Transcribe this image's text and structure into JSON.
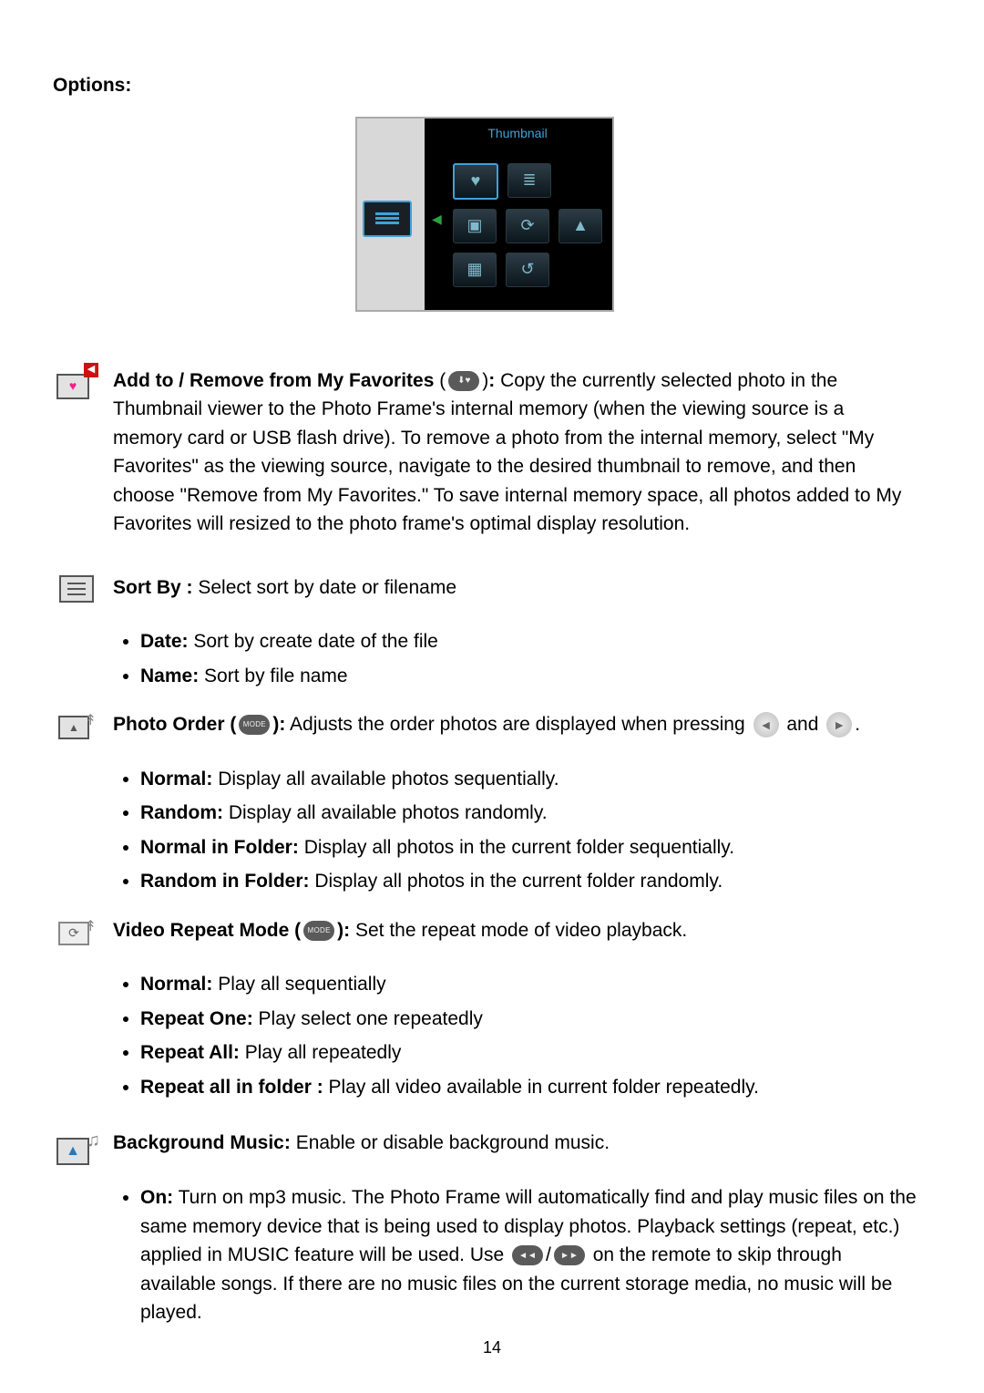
{
  "title": "Options:",
  "thumbnail_label": "Thumbnail",
  "favorites": {
    "heading": "Add to / Remove from My Favorites",
    "body": " Copy the currently selected photo in the Thumbnail viewer to the Photo Frame's internal memory (when the viewing source is a memory card or USB flash drive). To remove a photo from the internal memory, select \"My Favorites\" as the viewing source, navigate to the desired thumbnail to remove, and then choose \"Remove from My Favorites.\" To save internal memory space, all photos added to My Favorites will resized to the photo frame's optimal display resolution."
  },
  "sortby": {
    "heading": "Sort By :",
    "body": " Select sort by date or filename",
    "items": [
      {
        "label": "Date:",
        "text": " Sort by create date of the file"
      },
      {
        "label": "Name:",
        "text": " Sort by file name"
      }
    ]
  },
  "photoOrder": {
    "heading": "Photo Order (",
    "heading2": "):",
    "body": " Adjusts the order photos are displayed when pressing ",
    "and": " and ",
    "period": ".",
    "items": [
      {
        "label": "Normal:",
        "text": " Display all available photos sequentially."
      },
      {
        "label": "Random:",
        "text": " Display all available photos randomly."
      },
      {
        "label": "Normal in Folder:",
        "text": " Display all photos in the current folder sequentially."
      },
      {
        "label": "Random in Folder:",
        "text": " Display all photos in the current folder randomly."
      }
    ]
  },
  "videoRepeat": {
    "heading": "Video Repeat Mode (",
    "heading2": "):",
    "body": " Set the repeat mode of video playback.",
    "items": [
      {
        "label": "Normal:",
        "text": " Play all sequentially"
      },
      {
        "label": "Repeat One:",
        "text": " Play select one repeatedly"
      },
      {
        "label": "Repeat All:",
        "text": " Play all repeatedly"
      },
      {
        "label": "Repeat all in folder :",
        "text": " Play all video available in current folder repeatedly."
      }
    ]
  },
  "bgMusic": {
    "heading": "Background Music:",
    "body": " Enable or disable background music.",
    "on_label": "On:",
    "on_text1": " Turn on mp3 music. The Photo Frame will automatically find and play music files on the same memory device that is being used to display photos. Playback settings (repeat, etc.) applied in MUSIC feature will be used. Use ",
    "slash": "/",
    "on_text2": " on the remote to skip through available songs. If there are no music files on the current storage media, no music will be played."
  },
  "pageNumber": "14",
  "pill_mode": "MODE",
  "pill_prev": "◄◄",
  "pill_next": "►►"
}
